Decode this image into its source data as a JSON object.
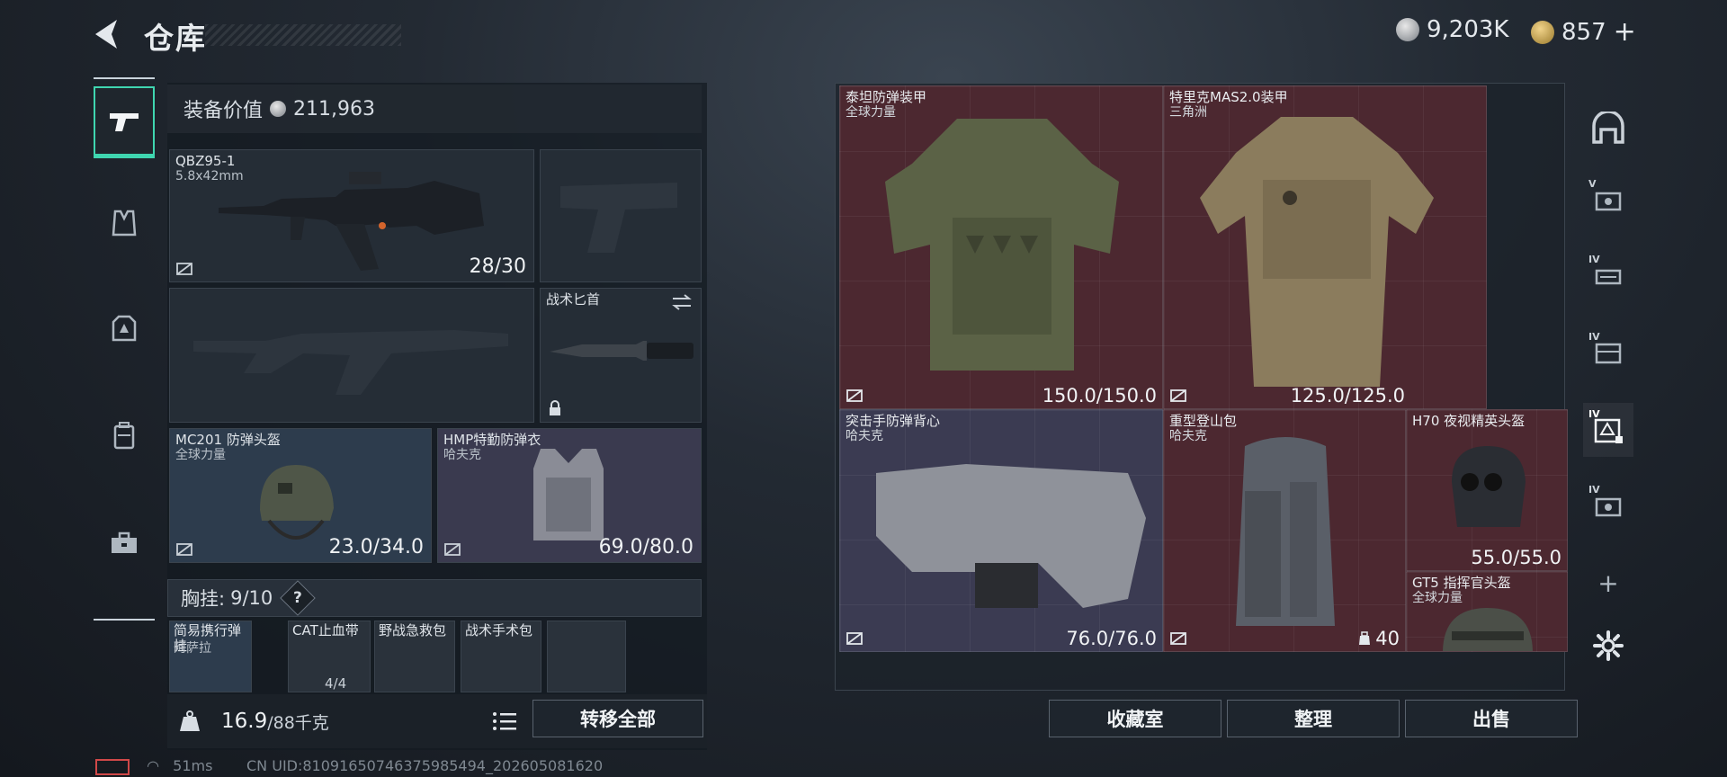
{
  "header": {
    "title": "仓库"
  },
  "currency": {
    "silver": "9,203K",
    "gold": "857",
    "gold_add": "+"
  },
  "loadout": {
    "value_label": "装备价值",
    "value": "211,963",
    "primary": {
      "name": "QBZ95-1",
      "ammo": "5.8x42mm",
      "durability": "28/30"
    },
    "melee": {
      "name": "战术匕首"
    },
    "helmet": {
      "name": "MC201 防弹头盔",
      "maker": "全球力量",
      "durability": "23.0/34.0"
    },
    "armor": {
      "name": "HMP特勤防弹衣",
      "maker": "哈夫克",
      "durability": "69.0/80.0"
    },
    "chest": {
      "label": "胸挂:",
      "count": "9",
      "capacity": "/10",
      "help": "?"
    },
    "chest_items": [
      {
        "name": "简易携行弹挂",
        "maker": "阿萨拉"
      },
      {
        "name": "CAT止血带",
        "maker": "",
        "stack": "4/4"
      },
      {
        "name": "野战急救包",
        "maker": ""
      },
      {
        "name": "战术手术包",
        "maker": ""
      }
    ],
    "weight": "16.9",
    "weight_max": "/88千克",
    "transfer_label": "转移全部"
  },
  "storage": {
    "items": [
      {
        "name": "泰坦防弹装甲",
        "maker": "全球力量",
        "durability": "150.0/150.0"
      },
      {
        "name": "特里克MAS2.0装甲",
        "maker": "三角洲",
        "durability": "125.0/125.0"
      },
      {
        "name": "突击手防弹背心",
        "maker": "哈夫克",
        "durability": "76.0/76.0"
      },
      {
        "name": "重型登山包",
        "maker": "哈夫克",
        "capacity": "40"
      },
      {
        "name": "H70 夜视精英头盔",
        "maker": "",
        "durability": "55.0/55.0"
      },
      {
        "name": "GT5 指挥官头盔",
        "maker": "全球力量"
      }
    ],
    "buttons": {
      "collection": "收藏室",
      "sort": "整理",
      "sell": "出售"
    }
  },
  "side_tiers": [
    "V",
    "IV",
    "IV",
    "IV",
    "IV"
  ],
  "add_symbol": "+",
  "status": {
    "ping": "51ms",
    "uid": "CN UID:8109165074637598549​4_202605081620"
  },
  "colors": {
    "accent": "#3fd6b0",
    "red_rarity": "#4c2830",
    "purple_rarity": "#3b3b52",
    "blue_rarity": "#2d3c4d"
  }
}
